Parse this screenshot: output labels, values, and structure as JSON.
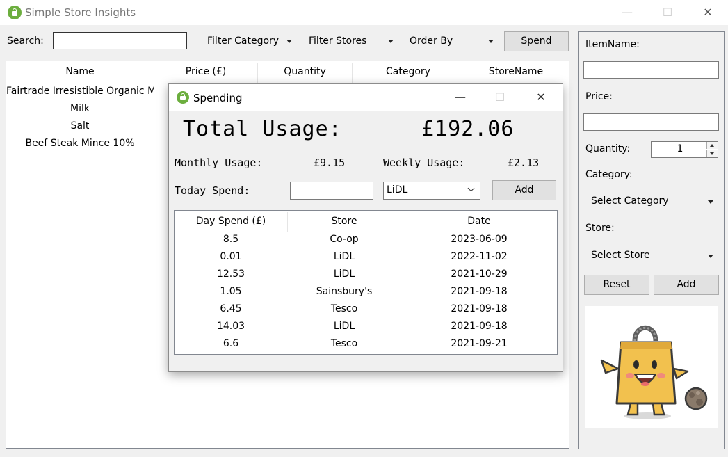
{
  "window": {
    "title": "Simple Store Insights",
    "controls": {
      "minimize": "—",
      "maximize": "☐",
      "close": "✕"
    }
  },
  "toolbar": {
    "search_label": "Search:",
    "search_value": "",
    "filter_category": "Filter Category",
    "filter_stores": "Filter Stores",
    "order_by": "Order By",
    "spend_button": "Spend"
  },
  "main_table": {
    "columns": [
      "Name",
      "Price (£)",
      "Quantity",
      "Category",
      "StoreName"
    ],
    "rows": [
      "Fairtrade Irresistible Organic M",
      "Milk",
      "Salt",
      "Beef Steak Mince 10%"
    ]
  },
  "right_panel": {
    "item_name_label": "ItemName:",
    "item_name_value": "",
    "price_label": "Price:",
    "price_value": "",
    "quantity_label": "Quantity:",
    "quantity_value": "1",
    "category_label": "Category:",
    "category_select": "Select Category",
    "store_label": "Store:",
    "store_select": "Select Store",
    "reset_button": "Reset",
    "add_button": "Add",
    "mascot_icon": "shopping-bag-mascot-icon"
  },
  "dialog": {
    "title": "Spending",
    "total_label": "Total Usage:",
    "total_value": "£192.06",
    "monthly_label": "Monthly Usage:",
    "monthly_value": "£9.15",
    "weekly_label": "Weekly Usage:",
    "weekly_value": "£2.13",
    "today_label": "Today Spend:",
    "today_value": "",
    "store_selected": "LiDL",
    "add_button": "Add",
    "table": {
      "columns": [
        "Day Spend (£)",
        "Store",
        "Date"
      ],
      "rows": [
        {
          "spend": "8.5",
          "store": "Co-op",
          "date": "2023-06-09"
        },
        {
          "spend": "0.01",
          "store": "LiDL",
          "date": "2022-11-02"
        },
        {
          "spend": "12.53",
          "store": "LiDL",
          "date": "2021-10-29"
        },
        {
          "spend": "1.05",
          "store": "Sainsbury's",
          "date": "2021-09-18"
        },
        {
          "spend": "6.45",
          "store": "Tesco",
          "date": "2021-09-18"
        },
        {
          "spend": "14.03",
          "store": "LiDL",
          "date": "2021-09-18"
        },
        {
          "spend": "6.6",
          "store": "Tesco",
          "date": "2021-09-21"
        }
      ]
    }
  },
  "colors": {
    "accent": "#6cae3e",
    "bag": "#f2c14e"
  }
}
